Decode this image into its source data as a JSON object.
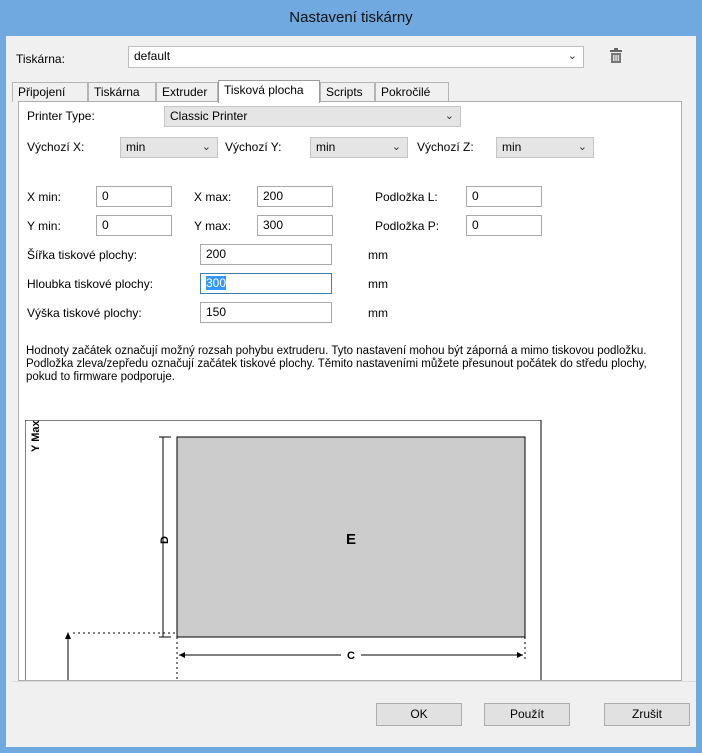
{
  "window": {
    "title": "Nastavení tiskárny"
  },
  "printer": {
    "label": "Tiskárna:",
    "value": "default"
  },
  "tabs": [
    "Připojení",
    "Tiskárna",
    "Extruder",
    "Tisková plocha",
    "Scripts",
    "Pokročilé"
  ],
  "active_tab": "Tisková plocha",
  "form": {
    "printer_type": {
      "label": "Printer Type:",
      "value": "Classic Printer"
    },
    "home_x": {
      "label": "Výchozí X:",
      "value": "min"
    },
    "home_y": {
      "label": "Výchozí Y:",
      "value": "min"
    },
    "home_z": {
      "label": "Výchozí Z:",
      "value": "min"
    },
    "xmin": {
      "label": "X min:",
      "value": "0"
    },
    "xmax": {
      "label": "X max:",
      "value": "200"
    },
    "bed_left": {
      "label": "Podložka L:",
      "value": "0"
    },
    "ymin": {
      "label": "Y min:",
      "value": "0"
    },
    "ymax": {
      "label": "Y max:",
      "value": "300"
    },
    "bed_front": {
      "label": "Podložka P:",
      "value": "0"
    },
    "width": {
      "label": "Šířka tiskové plochy:",
      "value": "200",
      "unit": "mm"
    },
    "depth": {
      "label": "Hloubka tiskové plochy:",
      "value": "300",
      "unit": "mm"
    },
    "height": {
      "label": "Výška tiskové plochy:",
      "value": "150",
      "unit": "mm"
    }
  },
  "note": "Hodnoty začátek označují možný rozsah pohybu extruderu. Tyto nastavení mohou být záporná a mimo tiskovou podložku. Podložka zleva/zepředu označují začátek tiskové plochy. Těmito nastaveními můžete přesunout počátek do středu plochy, pokud to firmware podporuje.",
  "diagram": {
    "ymax_label": "Y Max",
    "d_label": "D",
    "e_label": "E",
    "c_label": "C"
  },
  "buttons": {
    "ok": "OK",
    "apply": "Použít",
    "cancel": "Zrušit"
  },
  "colors": {
    "titlebar": "#6fa9e0",
    "bed": "#cccccc"
  }
}
